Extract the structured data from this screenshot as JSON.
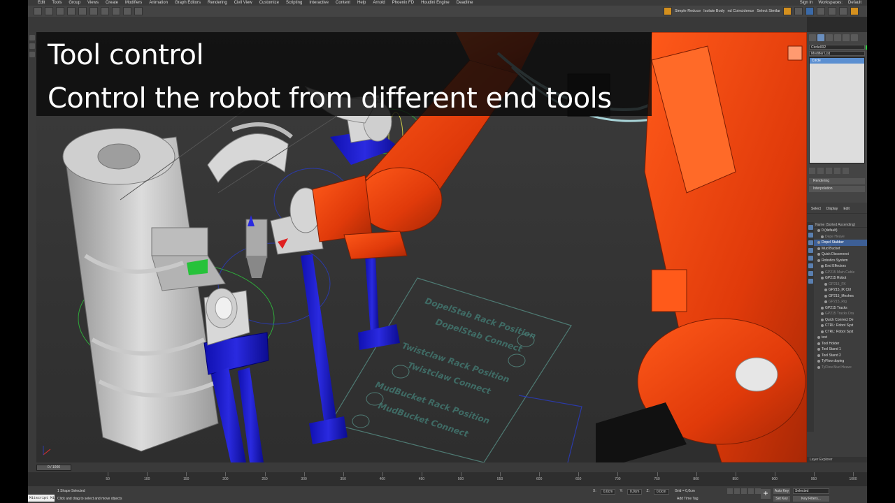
{
  "overlay": {
    "line1": "Tool control",
    "line2": "Control the robot from different end tools"
  },
  "menubar": {
    "items": [
      "Edit",
      "Tools",
      "Group",
      "Views",
      "Create",
      "Modifiers",
      "Animation",
      "Graph Editors",
      "Rendering",
      "Civil View",
      "Customize",
      "Scripting",
      "Interactive",
      "Content",
      "Help",
      "Arnold",
      "Phoenix FD",
      "Houdini Engine",
      "Deadline"
    ],
    "sign_in": "Sign In",
    "workspaces_label": "Workspaces:",
    "workspace_value": "Default"
  },
  "toolbar": {
    "simple_reduce": "Simple Reduce",
    "isolate_body": "Isolate Body",
    "nd_coincidence": "nd Coincidence",
    "select_similar": "Select Similar"
  },
  "command_panel": {
    "object_name": "Circle002",
    "modifier_list": "Modifier List",
    "modifier_item": "Circle",
    "rollouts": [
      "Rendering",
      "Interpolation"
    ],
    "name_color": "#33cc44"
  },
  "scene_explorer": {
    "tabs": [
      "Select",
      "Display",
      "Edit"
    ],
    "header": "Name (Sorted Ascending)",
    "rows": [
      {
        "label": "0 (default)",
        "indent": 1,
        "state": "normal"
      },
      {
        "label": "Depe Heave",
        "indent": 2,
        "state": "dim"
      },
      {
        "label": "Dopel Stabber",
        "indent": 1,
        "state": "selected"
      },
      {
        "label": "Mud Bucket",
        "indent": 1,
        "state": "normal"
      },
      {
        "label": "Quick Disconnect",
        "indent": 1,
        "state": "normal"
      },
      {
        "label": "Robotics System",
        "indent": 1,
        "state": "normal"
      },
      {
        "label": "End Effectors",
        "indent": 2,
        "state": "normal"
      },
      {
        "label": "GP215 Main Cable",
        "indent": 2,
        "state": "dim"
      },
      {
        "label": "GP215 Robot",
        "indent": 2,
        "state": "normal"
      },
      {
        "label": "GP215_FK",
        "indent": 3,
        "state": "dim"
      },
      {
        "label": "GP215_IK Ctrl",
        "indent": 3,
        "state": "normal"
      },
      {
        "label": "GP215_Meshes",
        "indent": 3,
        "state": "normal"
      },
      {
        "label": "GP215_Rig",
        "indent": 3,
        "state": "dim"
      },
      {
        "label": "GP215 Tracks",
        "indent": 2,
        "state": "normal"
      },
      {
        "label": "GP215 Tracks Dra",
        "indent": 2,
        "state": "dim"
      },
      {
        "label": "Quick Connect De",
        "indent": 2,
        "state": "normal"
      },
      {
        "label": "CTRL: Robot Syst",
        "indent": 2,
        "state": "normal"
      },
      {
        "label": "CTRL: Robot Syst",
        "indent": 2,
        "state": "normal"
      },
      {
        "label": "text",
        "indent": 1,
        "state": "normal"
      },
      {
        "label": "Tool Holder",
        "indent": 1,
        "state": "normal"
      },
      {
        "label": "Tool Stand 1",
        "indent": 1,
        "state": "normal"
      },
      {
        "label": "Tool Stand 2",
        "indent": 1,
        "state": "normal"
      },
      {
        "label": "TyFlow doping",
        "indent": 1,
        "state": "normal"
      },
      {
        "label": "TyFlow Mud Heave",
        "indent": 1,
        "state": "dim"
      }
    ],
    "layer_explorer": "Layer Explorer"
  },
  "viewport": {
    "floor_labels": [
      "DopelStab Rack Position",
      "DopelStab Connect",
      "Twistclaw Rack Position",
      "Twistclaw Connect",
      "MudBucket Rack Position",
      "MudBucket Connect"
    ]
  },
  "timeline": {
    "slider": "0 / 1000",
    "ticks": [
      "50",
      "100",
      "150",
      "200",
      "250",
      "300",
      "350",
      "400",
      "450",
      "500",
      "550",
      "600",
      "650",
      "700",
      "750",
      "800",
      "850",
      "900",
      "950",
      "1000"
    ]
  },
  "statusbar": {
    "maxscript": "Mitscript Mi",
    "status_line1": "1 Shape Selected",
    "status_line2": "Click and drag to select and move objects",
    "x_label": "X:",
    "x_value": "0,0cm",
    "y_label": "Y:",
    "y_value": "0,0cm",
    "z_label": "Z:",
    "z_value": "0,0cm",
    "grid": "Grid = 0,0cm",
    "add_time_tag": "Add Time Tag",
    "frame_value": "0",
    "auto_key": "Auto Key",
    "set_key": "Set Key",
    "selected": "Selected",
    "key_filters": "Key Filters..."
  }
}
